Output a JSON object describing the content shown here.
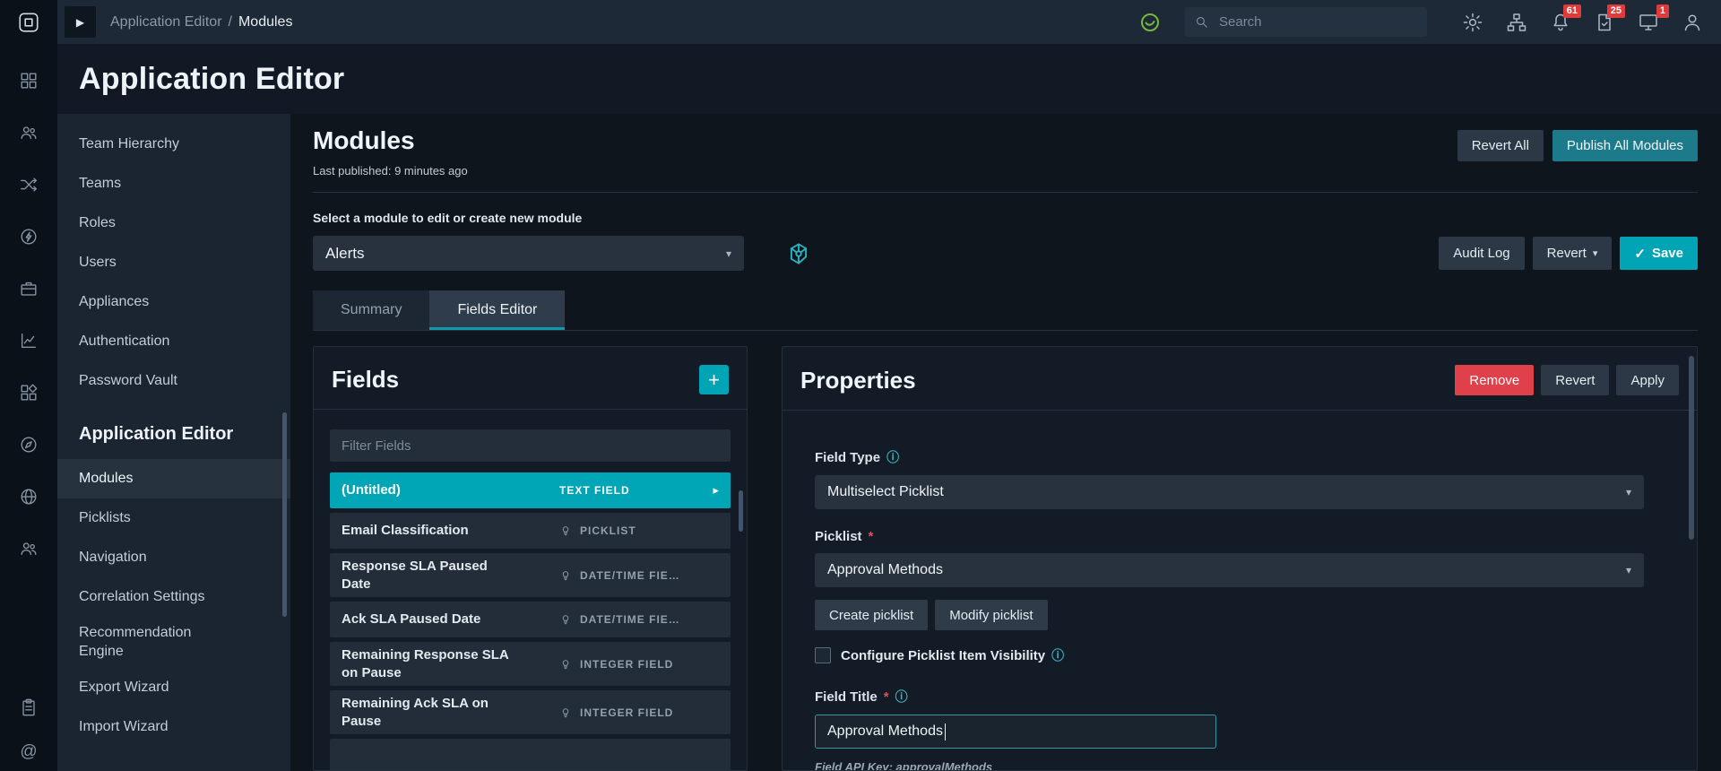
{
  "glyphs": {
    "play": "▶",
    "caret_down": "▾",
    "caret_right": "▸",
    "check": "✓",
    "info": "ⓘ",
    "asterisk": "*",
    "at": "@",
    "plus": "+",
    "slash": "/"
  },
  "topbar": {
    "breadcrumb_parent": "Application Editor",
    "breadcrumb_current": "Modules",
    "search_placeholder": "Search",
    "badge_notifications": "61",
    "badge_approvals": "25",
    "badge_queue": "1"
  },
  "page": {
    "title": "Application Editor"
  },
  "sidebar": {
    "items_top": [
      "Team Hierarchy",
      "Teams",
      "Roles",
      "Users",
      "Appliances",
      "Authentication",
      "Password Vault"
    ],
    "section_title": "Application Editor",
    "items_app": [
      "Modules",
      "Picklists",
      "Navigation",
      "Correlation Settings",
      "Recommendation Engine",
      "Export Wizard",
      "Import Wizard"
    ]
  },
  "modules_header": {
    "title": "Modules",
    "last_published": "Last published: 9 minutes ago",
    "revert_all_label": "Revert All",
    "publish_all_label": "Publish All Modules"
  },
  "module_select": {
    "label": "Select a module to edit or create new module",
    "value": "Alerts",
    "audit_log_label": "Audit Log",
    "revert_label": "Revert",
    "save_label": "Save"
  },
  "tabs": {
    "summary": "Summary",
    "fields_editor": "Fields Editor"
  },
  "fields": {
    "title": "Fields",
    "filter_placeholder": "Filter Fields",
    "rows": [
      {
        "name": "(Untitled)",
        "type": "TEXT FIELD"
      },
      {
        "name": "Email Classification",
        "type": "PICKLIST"
      },
      {
        "name": "Response SLA Paused Date",
        "type": "DATE/TIME FIE…"
      },
      {
        "name": "Ack SLA Paused Date",
        "type": "DATE/TIME FIE…"
      },
      {
        "name": "Remaining Response SLA on Pause",
        "type": "INTEGER FIELD"
      },
      {
        "name": "Remaining Ack SLA on Pause",
        "type": "INTEGER FIELD"
      }
    ]
  },
  "properties": {
    "title": "Properties",
    "remove_label": "Remove",
    "revert_label": "Revert",
    "apply_label": "Apply",
    "field_type_label": "Field Type",
    "field_type_value": "Multiselect Picklist",
    "picklist_label": "Picklist",
    "picklist_value": "Approval Methods",
    "create_picklist_label": "Create picklist",
    "modify_picklist_label": "Modify picklist",
    "visibility_label": "Configure Picklist Item Visibility",
    "field_title_label": "Field Title",
    "field_title_value": "Approval Methods",
    "api_key_text": "Field API Key: approvalMethods"
  },
  "colors": {
    "accent_teal": "#00a4b4",
    "publish_teal": "#1d7a8b",
    "danger_red": "#df4049",
    "badge_red": "#e03b3b",
    "health_green": "#76b83f",
    "selected_row_teal": "#00a6b6"
  }
}
